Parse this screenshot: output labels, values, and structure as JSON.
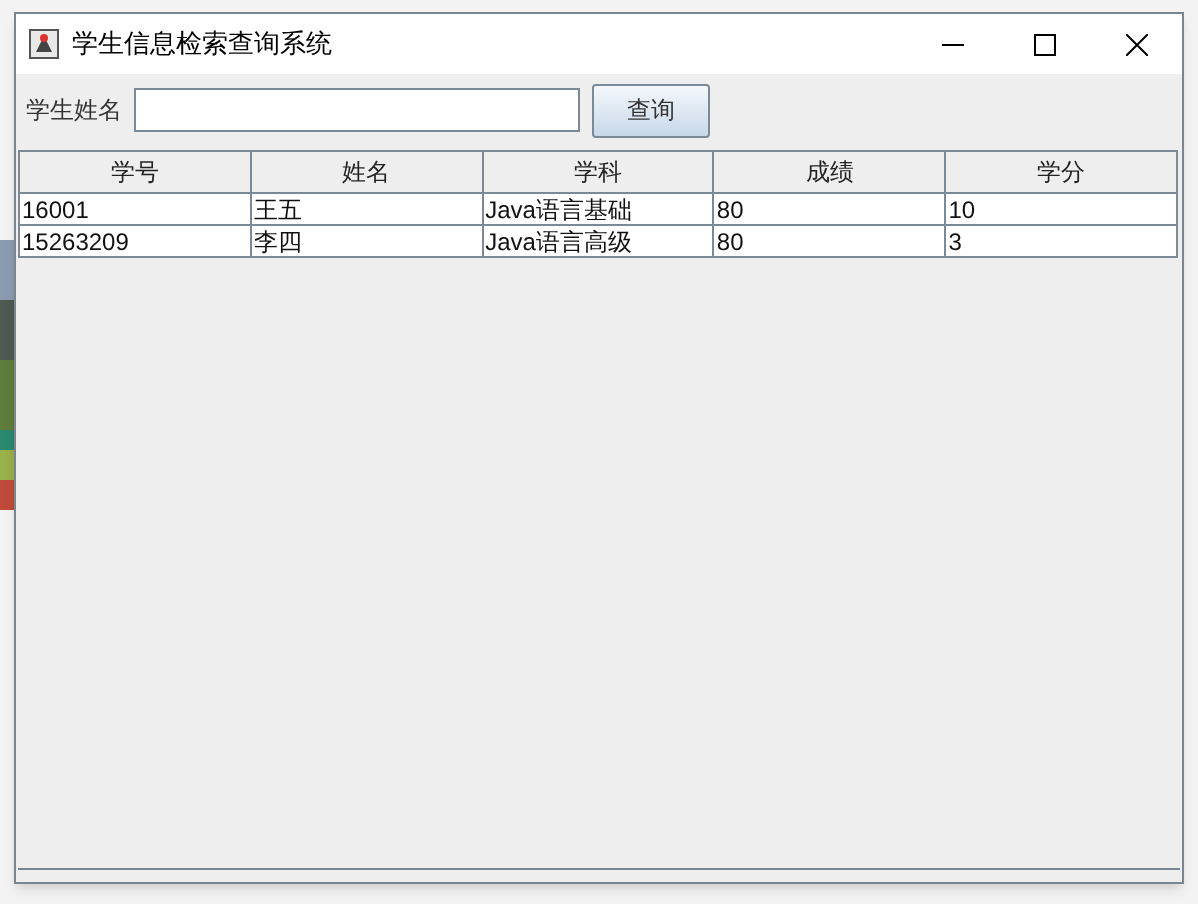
{
  "window": {
    "title": "学生信息检索查询系统"
  },
  "search": {
    "label": "学生姓名",
    "button": "查询"
  },
  "table": {
    "columns": [
      "学号",
      "姓名",
      "学科",
      "成绩",
      "学分"
    ],
    "rows": [
      [
        "16001",
        "王五",
        "Java语言基础",
        "80",
        "10"
      ],
      [
        "15263209",
        "李四",
        "Java语言高级",
        "80",
        "3"
      ]
    ]
  }
}
